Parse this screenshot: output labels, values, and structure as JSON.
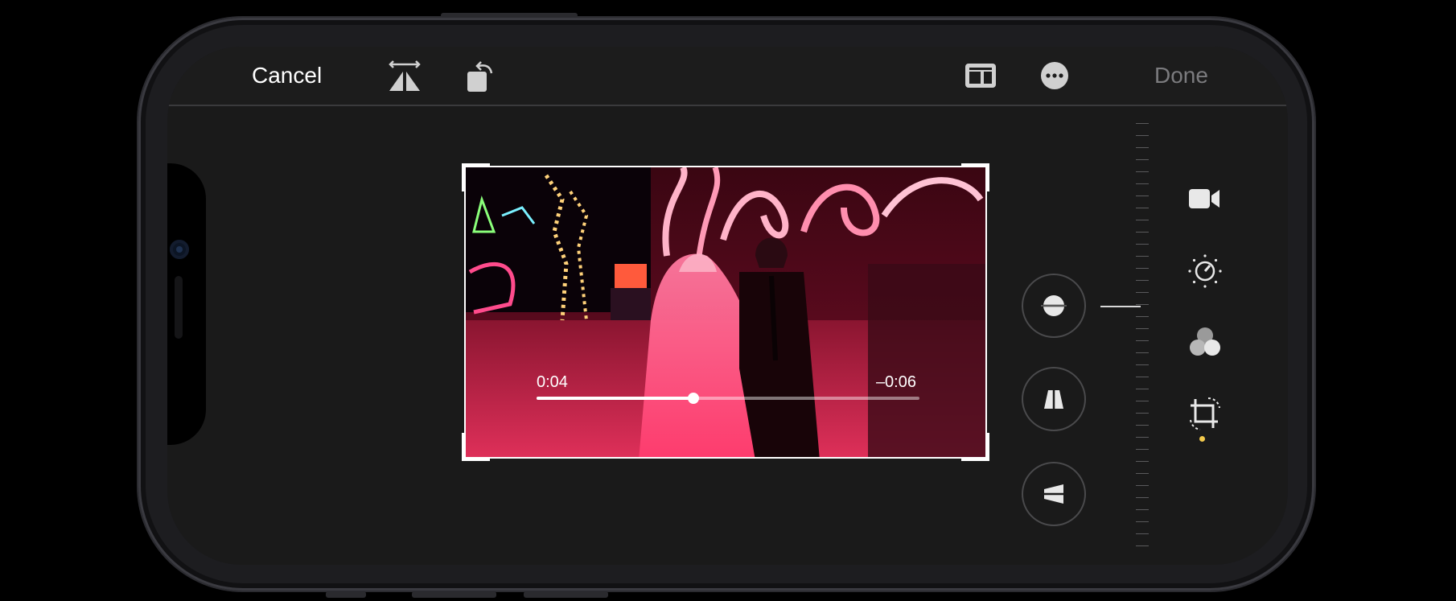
{
  "toolbar": {
    "cancel_label": "Cancel",
    "done_label": "Done",
    "icons": [
      "flip-horizontal-icon",
      "rotate-icon",
      "aspect-ratio-icon",
      "more-icon"
    ]
  },
  "video": {
    "elapsed": "0:04",
    "remaining": "–0:06",
    "progress": 0.41
  },
  "adjustments": [
    "straighten-icon",
    "vertical-perspective-icon",
    "horizontal-perspective-icon"
  ],
  "modes": [
    "video-icon",
    "adjust-icon",
    "filters-icon",
    "crop-icon"
  ],
  "colors": {
    "background": "#1a1a1a",
    "text": "#ffffff",
    "done_disabled": "#7b7b7e",
    "accent": "#f2c94c"
  }
}
